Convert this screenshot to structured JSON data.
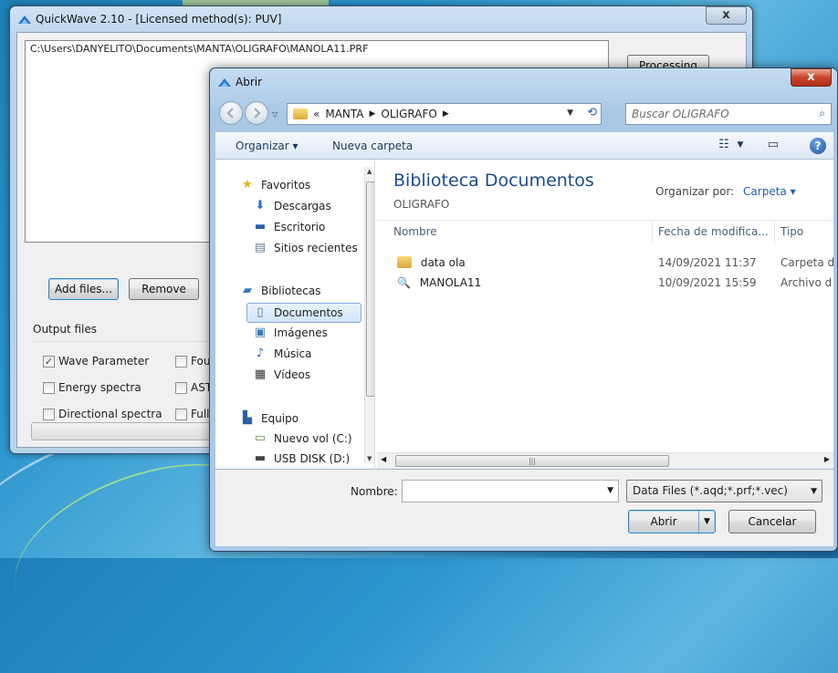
{
  "quickwave": {
    "title": "QuickWave 2.10 - [Licensed method(s): PUV]",
    "close_label": "x",
    "file_path": "C:\\Users\\DANYELITO\\Documents\\MANTA\\OLIGRAFO\\MANOLA11.PRF",
    "processing_label": "Processing",
    "add_files_label": "Add files...",
    "remove_label": "Remove",
    "output_files_label": "Output files",
    "checkboxes": [
      {
        "label": "Wave Parameter",
        "checked": true
      },
      {
        "label": "Fou",
        "checked": false
      },
      {
        "label": "Energy spectra",
        "checked": false
      },
      {
        "label": "AST",
        "checked": false
      },
      {
        "label": "Directional spectra",
        "checked": false
      },
      {
        "label": "Full",
        "checked": false
      }
    ]
  },
  "dialog": {
    "title": "Abrir",
    "close_label": "x",
    "address": {
      "prefix": "«",
      "crumbs": [
        "MANTA",
        "OLIGRAFO"
      ]
    },
    "search_placeholder": "Buscar OLIGRAFO",
    "toolbar": {
      "organize_label": "Organizar ▾",
      "new_folder_label": "Nueva carpeta"
    },
    "nav": {
      "favorites_label": "Favoritos",
      "favorites": [
        "Descargas",
        "Escritorio",
        "Sitios recientes"
      ],
      "libraries_label": "Bibliotecas",
      "libraries": [
        "Documentos",
        "Imágenes",
        "Música",
        "Vídeos"
      ],
      "computer_label": "Equipo",
      "drives": [
        "Nuevo vol (C:)",
        "USB DISK (D:)"
      ],
      "selected": "Documentos"
    },
    "library_title": "Biblioteca Documentos",
    "library_subtitle": "OLIGRAFO",
    "organize_by_label": "Organizar por:",
    "organize_by_value": "Carpeta ▾",
    "columns": [
      "Nombre",
      "Fecha de modifica...",
      "Tipo"
    ],
    "files": [
      {
        "name": "data ola",
        "date": "14/09/2021 11:37",
        "type": "Carpeta d",
        "kind": "folder"
      },
      {
        "name": "MANOLA11",
        "date": "10/09/2021 15:59",
        "type": "Archivo d",
        "kind": "file"
      }
    ],
    "name_label": "Nombre:",
    "name_value": "",
    "filter_value": "Data Files (*.aqd;*.prf;*.vec)",
    "open_label": "Abrir",
    "cancel_label": "Cancelar"
  },
  "colors": {
    "accent": "#1e4a8c",
    "link": "#1f5eac",
    "close_red": "#c9442c"
  }
}
